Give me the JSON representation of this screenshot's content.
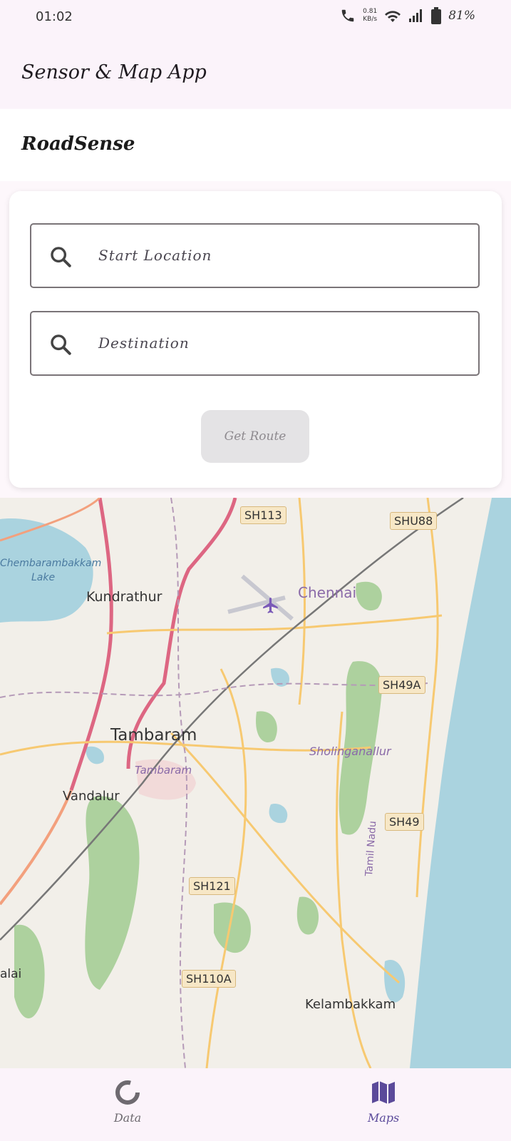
{
  "status": {
    "time": "01:02",
    "net_speed_value": "0.81",
    "net_speed_unit": "KB/s",
    "battery": "81%"
  },
  "appbar": {
    "title": "Sensor & Map App"
  },
  "section": {
    "title": "RoadSense"
  },
  "form": {
    "start_placeholder": "Start Location",
    "destination_placeholder": "Destination",
    "get_route_label": "Get Route"
  },
  "map": {
    "places": {
      "lake": "Chembarambakkam",
      "lake2": "Lake",
      "kundrathur": "Kundrathur",
      "chennai": "Chennai",
      "tambaram": "Tambaram",
      "tambaram_area": "Tambaram",
      "vandalur": "Vandalur",
      "sholinganallur": "Sholinganallur",
      "kelambakkam": "Kelambakkam",
      "tamil_nadu": "Tamil Nadu",
      "alai": "alai"
    },
    "roads": [
      "SH113",
      "SHU88",
      "SH49A",
      "SH49",
      "SH121",
      "SH110A"
    ]
  },
  "nav": {
    "items": [
      {
        "label": "Data",
        "icon": "data-donut-icon"
      },
      {
        "label": "Maps",
        "icon": "map-icon"
      }
    ],
    "active": "Maps",
    "active_color": "#5b4a9a",
    "inactive_color": "#6e6a70"
  }
}
